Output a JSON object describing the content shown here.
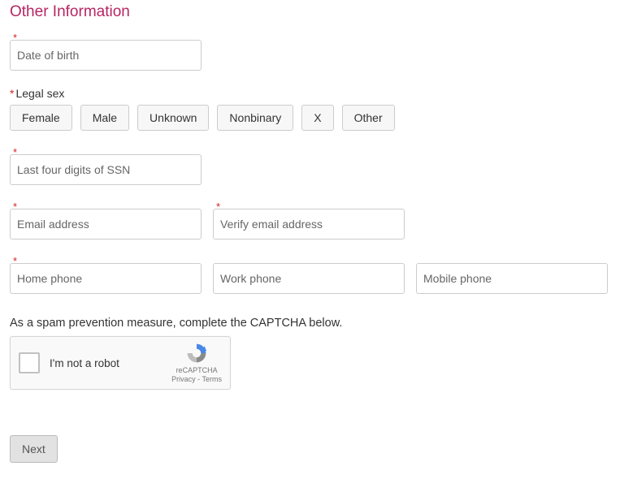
{
  "section_title": "Other Information",
  "required_marker": "*",
  "dob": {
    "placeholder": "Date of birth"
  },
  "legal_sex": {
    "label": "Legal sex",
    "options": [
      "Female",
      "Male",
      "Unknown",
      "Nonbinary",
      "X",
      "Other"
    ]
  },
  "ssn": {
    "placeholder": "Last four digits of SSN"
  },
  "email": {
    "placeholder": "Email address"
  },
  "verify_email": {
    "placeholder": "Verify email address"
  },
  "home_phone": {
    "placeholder": "Home phone"
  },
  "work_phone": {
    "placeholder": "Work phone"
  },
  "mobile_phone": {
    "placeholder": "Mobile phone"
  },
  "captcha": {
    "instruction": "As a spam prevention measure, complete the CAPTCHA below.",
    "checkbox_label": "I'm not a robot",
    "brand": "reCAPTCHA",
    "privacy": "Privacy",
    "terms": "Terms"
  },
  "next_button": "Next"
}
